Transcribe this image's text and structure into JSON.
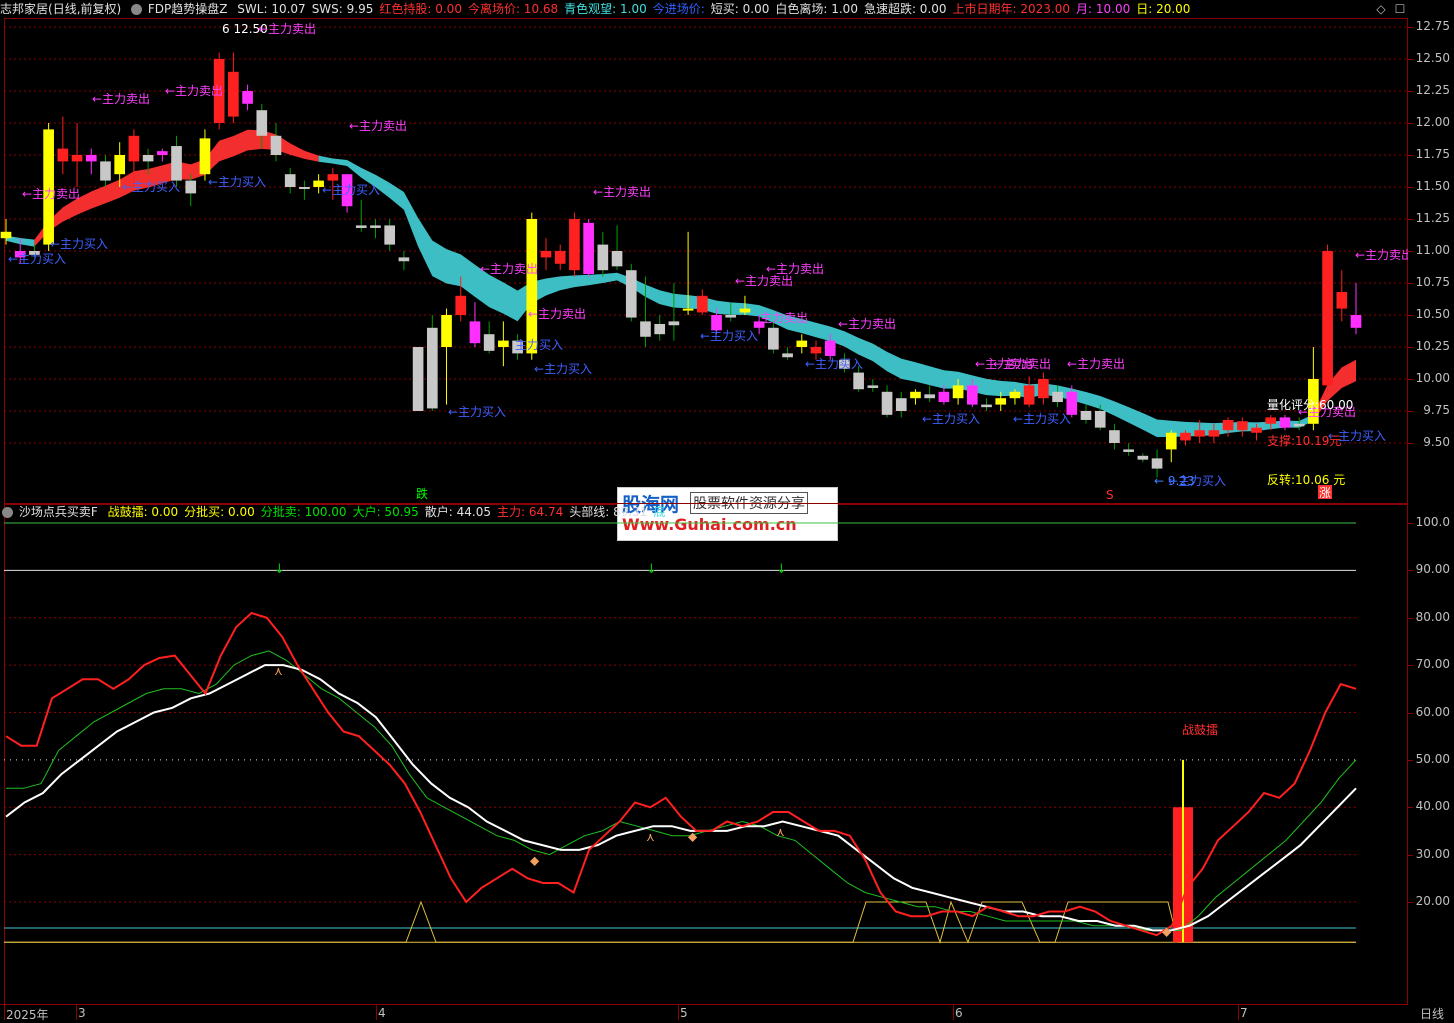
{
  "main_header": {
    "app": "志邦家居",
    "period": "(日线,前复权)",
    "indicator": "FDP趋势操盘Z",
    "items": [
      {
        "label": "SWL: 10.07",
        "color": "#e0e0e0"
      },
      {
        "label": "SWS: 9.95",
        "color": "#e0e0e0"
      },
      {
        "label": "红色持股: 0.00",
        "color": "#ff3030"
      },
      {
        "label": "今离场价: 10.68",
        "color": "#ff3030"
      },
      {
        "label": "青色观望: 1.00",
        "color": "#40e0e0"
      },
      {
        "label": "今进场价:",
        "color": "#3060ff"
      },
      {
        "label": "短买: 0.00",
        "color": "#e0e0e0"
      },
      {
        "label": "白色离场: 1.00",
        "color": "#e0e0e0"
      },
      {
        "label": "急速超跌: 0.00",
        "color": "#e0e0e0"
      },
      {
        "label": "上市日期年: 2023.00",
        "color": "#ff3030"
      },
      {
        "label": "月: 10.00",
        "color": "#ff40ff"
      },
      {
        "label": "日: 20.00",
        "color": "#ffff00"
      }
    ]
  },
  "sub_header": {
    "indicator": "沙场点兵买卖F",
    "items": [
      {
        "label": "战鼓擂: 0.00",
        "color": "#ffff00"
      },
      {
        "label": "分批买: 0.00",
        "color": "#ffff00"
      },
      {
        "label": "分批卖: 100.00",
        "color": "#00e000"
      },
      {
        "label": "大户: 50.95",
        "color": "#00e000"
      },
      {
        "label": "散户: 44.05",
        "color": "#e0e0e0"
      },
      {
        "label": "主力: 64.74",
        "color": "#ff3030"
      },
      {
        "label": "头部线: 89.31",
        "color": "#e0e0e0"
      },
      {
        "label": "底",
        "color": "#40e0e0"
      }
    ]
  },
  "price_axis": [
    "12.75",
    "12.50",
    "12.25",
    "12.00",
    "11.75",
    "11.50",
    "11.25",
    "11.00",
    "10.75",
    "10.50",
    "10.25",
    "10.00",
    "9.75",
    "9.50"
  ],
  "osc_axis": [
    "100.0",
    "90.00",
    "80.00",
    "70.00",
    "60.00",
    "50.00",
    "40.00",
    "30.00",
    "20.00"
  ],
  "x_axis": [
    "2025年",
    "3",
    "4",
    "5",
    "6",
    "7"
  ],
  "period_label": "日线",
  "annotations": {
    "high_price": "12.50",
    "low_price": "9.23",
    "sell": "←主力卖出",
    "buy": "←主力买入",
    "sell_short": "主力卖出",
    "buy_short": "主力买入",
    "quant_score": "量化评分:60.00",
    "support": "支撑:10.19元",
    "reversal": "反转:10.06 元",
    "down_mark": "跌",
    "up_mark": "涨",
    "s_mark": "S",
    "drum_label": "战鼓擂"
  },
  "watermark": {
    "brand": "股海网",
    "tagline": "股票软件资源分享",
    "url": "Www.Guhai.com.cn"
  },
  "colors": {
    "up": "#ff2020",
    "down": "#c8c8c8",
    "yellow": "#ffff00",
    "magenta": "#ff30ff",
    "red_band": "#ff3030",
    "cyan_band": "#40c8d0",
    "grid": "#8b0000"
  },
  "chart_data": {
    "type": "candlestick",
    "ylim": [
      9.3,
      12.8
    ],
    "candles": [
      {
        "o": 11.15,
        "h": 11.25,
        "l": 11.05,
        "c": 11.1,
        "k": "y"
      },
      {
        "o": 11.0,
        "h": 11.1,
        "l": 10.9,
        "c": 10.95,
        "k": "m"
      },
      {
        "o": 11.0,
        "h": 11.05,
        "l": 10.95,
        "c": 10.97,
        "k": "g"
      },
      {
        "o": 11.05,
        "h": 12.0,
        "l": 11.0,
        "c": 11.95,
        "k": "y"
      },
      {
        "o": 11.7,
        "h": 12.05,
        "l": 11.6,
        "c": 11.8,
        "k": "r"
      },
      {
        "o": 11.75,
        "h": 12.0,
        "l": 11.5,
        "c": 11.7,
        "k": "r"
      },
      {
        "o": 11.75,
        "h": 11.8,
        "l": 11.6,
        "c": 11.7,
        "k": "m"
      },
      {
        "o": 11.55,
        "h": 11.75,
        "l": 11.5,
        "c": 11.7,
        "k": "g"
      },
      {
        "o": 11.6,
        "h": 11.85,
        "l": 11.5,
        "c": 11.75,
        "k": "y"
      },
      {
        "o": 11.7,
        "h": 11.95,
        "l": 11.5,
        "c": 11.9,
        "k": "r"
      },
      {
        "o": 11.75,
        "h": 11.8,
        "l": 11.6,
        "c": 11.7,
        "k": "g"
      },
      {
        "o": 11.75,
        "h": 11.8,
        "l": 11.7,
        "c": 11.78,
        "k": "m"
      },
      {
        "o": 11.55,
        "h": 11.9,
        "l": 11.5,
        "c": 11.82,
        "k": "g"
      },
      {
        "o": 11.45,
        "h": 11.6,
        "l": 11.35,
        "c": 11.55,
        "k": "g"
      },
      {
        "o": 11.6,
        "h": 11.95,
        "l": 11.55,
        "c": 11.88,
        "k": "y"
      },
      {
        "o": 12.0,
        "h": 12.55,
        "l": 11.95,
        "c": 12.5,
        "k": "r"
      },
      {
        "o": 12.4,
        "h": 12.55,
        "l": 12.0,
        "c": 12.05,
        "k": "r"
      },
      {
        "o": 12.25,
        "h": 12.3,
        "l": 12.1,
        "c": 12.15,
        "k": "m"
      },
      {
        "o": 12.1,
        "h": 12.15,
        "l": 11.8,
        "c": 11.9,
        "k": "g"
      },
      {
        "o": 11.9,
        "h": 12.0,
        "l": 11.7,
        "c": 11.75,
        "k": "g"
      },
      {
        "o": 11.6,
        "h": 11.65,
        "l": 11.45,
        "c": 11.5,
        "k": "g"
      },
      {
        "o": 11.5,
        "h": 11.55,
        "l": 11.4,
        "c": 11.5,
        "k": "g"
      },
      {
        "o": 11.5,
        "h": 11.6,
        "l": 11.45,
        "c": 11.55,
        "k": "y"
      },
      {
        "o": 11.55,
        "h": 11.65,
        "l": 11.4,
        "c": 11.6,
        "k": "r"
      },
      {
        "o": 11.35,
        "h": 11.6,
        "l": 11.3,
        "c": 11.6,
        "k": "m"
      },
      {
        "o": 11.2,
        "h": 11.4,
        "l": 11.15,
        "c": 11.18,
        "k": "g"
      },
      {
        "o": 11.2,
        "h": 11.25,
        "l": 11.1,
        "c": 11.18,
        "k": "g"
      },
      {
        "o": 11.2,
        "h": 11.25,
        "l": 11.0,
        "c": 11.05,
        "k": "g"
      },
      {
        "o": 10.95,
        "h": 11.0,
        "l": 10.85,
        "c": 10.92,
        "k": "g"
      },
      {
        "o": 10.25,
        "h": 10.25,
        "l": 9.75,
        "c": 9.75,
        "k": "g"
      },
      {
        "o": 10.4,
        "h": 10.5,
        "l": 9.75,
        "c": 9.77,
        "k": "g"
      },
      {
        "o": 10.25,
        "h": 10.55,
        "l": 9.8,
        "c": 10.5,
        "k": "y"
      },
      {
        "o": 10.5,
        "h": 10.8,
        "l": 10.45,
        "c": 10.65,
        "k": "r"
      },
      {
        "o": 10.45,
        "h": 10.6,
        "l": 10.25,
        "c": 10.28,
        "k": "m"
      },
      {
        "o": 10.35,
        "h": 10.45,
        "l": 10.2,
        "c": 10.22,
        "k": "g"
      },
      {
        "o": 10.25,
        "h": 10.45,
        "l": 10.1,
        "c": 10.3,
        "k": "y"
      },
      {
        "o": 10.3,
        "h": 10.35,
        "l": 10.15,
        "c": 10.2,
        "k": "g"
      },
      {
        "o": 10.2,
        "h": 11.3,
        "l": 10.15,
        "c": 11.25,
        "k": "y"
      },
      {
        "o": 11.0,
        "h": 11.1,
        "l": 10.85,
        "c": 10.95,
        "k": "r"
      },
      {
        "o": 11.0,
        "h": 11.05,
        "l": 10.85,
        "c": 10.9,
        "k": "r"
      },
      {
        "o": 11.25,
        "h": 11.3,
        "l": 10.8,
        "c": 10.85,
        "k": "r"
      },
      {
        "o": 11.22,
        "h": 11.25,
        "l": 10.8,
        "c": 10.82,
        "k": "m"
      },
      {
        "o": 11.05,
        "h": 11.15,
        "l": 10.8,
        "c": 10.85,
        "k": "g"
      },
      {
        "o": 11.0,
        "h": 11.2,
        "l": 10.85,
        "c": 10.88,
        "k": "g"
      },
      {
        "o": 10.85,
        "h": 10.9,
        "l": 10.45,
        "c": 10.48,
        "k": "g"
      },
      {
        "o": 10.45,
        "h": 10.8,
        "l": 10.25,
        "c": 10.33,
        "k": "g"
      },
      {
        "o": 10.43,
        "h": 10.5,
        "l": 10.3,
        "c": 10.35,
        "k": "g"
      },
      {
        "o": 10.42,
        "h": 10.75,
        "l": 10.3,
        "c": 10.45,
        "k": "g"
      },
      {
        "o": 10.55,
        "h": 11.15,
        "l": 10.5,
        "c": 10.55,
        "k": "y"
      },
      {
        "o": 10.65,
        "h": 10.7,
        "l": 10.5,
        "c": 10.52,
        "k": "r"
      },
      {
        "o": 10.5,
        "h": 10.55,
        "l": 10.35,
        "c": 10.38,
        "k": "m"
      },
      {
        "o": 10.5,
        "h": 10.6,
        "l": 10.45,
        "c": 10.48,
        "k": "g"
      },
      {
        "o": 10.55,
        "h": 10.65,
        "l": 10.5,
        "c": 10.52,
        "k": "y"
      },
      {
        "o": 10.4,
        "h": 10.5,
        "l": 10.35,
        "c": 10.45,
        "k": "m"
      },
      {
        "o": 10.4,
        "h": 10.45,
        "l": 10.2,
        "c": 10.23,
        "k": "g"
      },
      {
        "o": 10.2,
        "h": 10.25,
        "l": 10.15,
        "c": 10.17,
        "k": "g"
      },
      {
        "o": 10.3,
        "h": 10.35,
        "l": 10.2,
        "c": 10.25,
        "k": "y"
      },
      {
        "o": 10.25,
        "h": 10.3,
        "l": 10.15,
        "c": 10.2,
        "k": "r"
      },
      {
        "o": 10.3,
        "h": 10.35,
        "l": 10.15,
        "c": 10.18,
        "k": "m"
      },
      {
        "o": 10.15,
        "h": 10.2,
        "l": 10.05,
        "c": 10.08,
        "k": "g"
      },
      {
        "o": 10.05,
        "h": 10.1,
        "l": 9.9,
        "c": 9.92,
        "k": "g"
      },
      {
        "o": 9.95,
        "h": 10.0,
        "l": 9.9,
        "c": 9.93,
        "k": "g"
      },
      {
        "o": 9.9,
        "h": 9.95,
        "l": 9.7,
        "c": 9.72,
        "k": "g"
      },
      {
        "o": 9.85,
        "h": 9.9,
        "l": 9.7,
        "c": 9.75,
        "k": "g"
      },
      {
        "o": 9.85,
        "h": 9.92,
        "l": 9.8,
        "c": 9.9,
        "k": "y"
      },
      {
        "o": 9.88,
        "h": 9.95,
        "l": 9.82,
        "c": 9.85,
        "k": "g"
      },
      {
        "o": 9.9,
        "h": 9.95,
        "l": 9.8,
        "c": 9.82,
        "k": "m"
      },
      {
        "o": 9.85,
        "h": 10.0,
        "l": 9.8,
        "c": 9.95,
        "k": "y"
      },
      {
        "o": 9.95,
        "h": 10.0,
        "l": 9.78,
        "c": 9.8,
        "k": "m"
      },
      {
        "o": 9.8,
        "h": 9.85,
        "l": 9.75,
        "c": 9.78,
        "k": "g"
      },
      {
        "o": 9.8,
        "h": 9.9,
        "l": 9.75,
        "c": 9.85,
        "k": "y"
      },
      {
        "o": 9.85,
        "h": 9.92,
        "l": 9.8,
        "c": 9.9,
        "k": "y"
      },
      {
        "o": 9.95,
        "h": 10.02,
        "l": 9.78,
        "c": 9.8,
        "k": "r"
      },
      {
        "o": 9.85,
        "h": 10.05,
        "l": 9.8,
        "c": 10.0,
        "k": "r"
      },
      {
        "o": 9.9,
        "h": 9.95,
        "l": 9.78,
        "c": 9.82,
        "k": "g"
      },
      {
        "o": 9.9,
        "h": 9.95,
        "l": 9.7,
        "c": 9.72,
        "k": "m"
      },
      {
        "o": 9.75,
        "h": 9.8,
        "l": 9.65,
        "c": 9.68,
        "k": "g"
      },
      {
        "o": 9.75,
        "h": 9.8,
        "l": 9.6,
        "c": 9.62,
        "k": "g"
      },
      {
        "o": 9.6,
        "h": 9.65,
        "l": 9.45,
        "c": 9.5,
        "k": "g"
      },
      {
        "o": 9.45,
        "h": 9.5,
        "l": 9.4,
        "c": 9.43,
        "k": "g"
      },
      {
        "o": 9.4,
        "h": 9.42,
        "l": 9.35,
        "c": 9.37,
        "k": "g"
      },
      {
        "o": 9.38,
        "h": 9.45,
        "l": 9.23,
        "c": 9.3,
        "k": "g"
      },
      {
        "o": 9.45,
        "h": 9.6,
        "l": 9.35,
        "c": 9.58,
        "k": "y"
      },
      {
        "o": 9.52,
        "h": 9.6,
        "l": 9.48,
        "c": 9.58,
        "k": "r"
      },
      {
        "o": 9.55,
        "h": 9.68,
        "l": 9.5,
        "c": 9.6,
        "k": "r"
      },
      {
        "o": 9.55,
        "h": 9.65,
        "l": 9.5,
        "c": 9.6,
        "k": "r"
      },
      {
        "o": 9.6,
        "h": 9.7,
        "l": 9.55,
        "c": 9.68,
        "k": "r"
      },
      {
        "o": 9.6,
        "h": 9.7,
        "l": 9.55,
        "c": 9.67,
        "k": "r"
      },
      {
        "o": 9.58,
        "h": 9.65,
        "l": 9.52,
        "c": 9.62,
        "k": "r"
      },
      {
        "o": 9.65,
        "h": 9.72,
        "l": 9.6,
        "c": 9.7,
        "k": "r"
      },
      {
        "o": 9.62,
        "h": 9.72,
        "l": 9.6,
        "c": 9.7,
        "k": "m"
      },
      {
        "o": 9.65,
        "h": 9.7,
        "l": 9.6,
        "c": 9.63,
        "k": "g"
      },
      {
        "o": 9.65,
        "h": 10.25,
        "l": 9.6,
        "c": 10.0,
        "k": "y"
      },
      {
        "o": 9.95,
        "h": 11.05,
        "l": 9.9,
        "c": 11.0,
        "k": "r"
      },
      {
        "o": 10.55,
        "h": 10.85,
        "l": 10.45,
        "c": 10.68,
        "k": "r"
      },
      {
        "o": 10.5,
        "h": 10.75,
        "l": 10.35,
        "c": 10.4,
        "k": "m"
      }
    ],
    "osc": {
      "ylim": [
        10,
        105
      ],
      "red": [
        55,
        53,
        53,
        63,
        65,
        67,
        67,
        65,
        67,
        70,
        71.5,
        72,
        68,
        64,
        72,
        78,
        81,
        80,
        76,
        70,
        65,
        60,
        56,
        55,
        52,
        49,
        45,
        39,
        32,
        25,
        20,
        23,
        25,
        27,
        25,
        24,
        24,
        22,
        31,
        34,
        37,
        41,
        40,
        42,
        38,
        35,
        35,
        37,
        36,
        37,
        39,
        39,
        37,
        35,
        35,
        34,
        29,
        22,
        18,
        17,
        17,
        18,
        18,
        17,
        19,
        18,
        17,
        17,
        18,
        18,
        19,
        18,
        16,
        15,
        14,
        13,
        15,
        23,
        27,
        33,
        36,
        39,
        43,
        42,
        45,
        52,
        60,
        66,
        65
      ],
      "green": [
        44,
        44,
        45,
        52,
        55,
        58,
        60,
        62,
        64,
        65,
        65,
        64,
        66,
        70,
        72,
        73,
        71,
        68,
        65,
        63,
        60,
        57,
        53,
        47,
        42,
        40,
        38,
        36,
        34,
        33,
        31,
        30,
        32,
        34,
        35,
        37,
        36,
        35,
        34,
        34,
        35,
        36,
        37,
        36,
        34,
        33,
        30,
        27,
        24,
        22,
        21,
        20,
        19,
        19,
        18,
        18,
        17,
        16,
        16,
        16,
        16,
        16,
        15,
        15,
        15,
        14,
        14,
        14,
        17,
        21,
        24,
        27,
        30,
        33,
        37,
        41,
        46,
        50
      ],
      "white": [
        38,
        41,
        43,
        47,
        50,
        53,
        56,
        58,
        60,
        61,
        63,
        64,
        66,
        68,
        70,
        70,
        69,
        67,
        64,
        62,
        59,
        54,
        49,
        45,
        42,
        40,
        37,
        35,
        33,
        32,
        31,
        31,
        32,
        34,
        35,
        36,
        36,
        35,
        35,
        35,
        36,
        36,
        37,
        36,
        35,
        34,
        31,
        28,
        25,
        23,
        22,
        21,
        20,
        19,
        18,
        18,
        17,
        17,
        16,
        16,
        15,
        15,
        14,
        14,
        15,
        17,
        20,
        23,
        26,
        29,
        32,
        36,
        40,
        44
      ]
    }
  }
}
